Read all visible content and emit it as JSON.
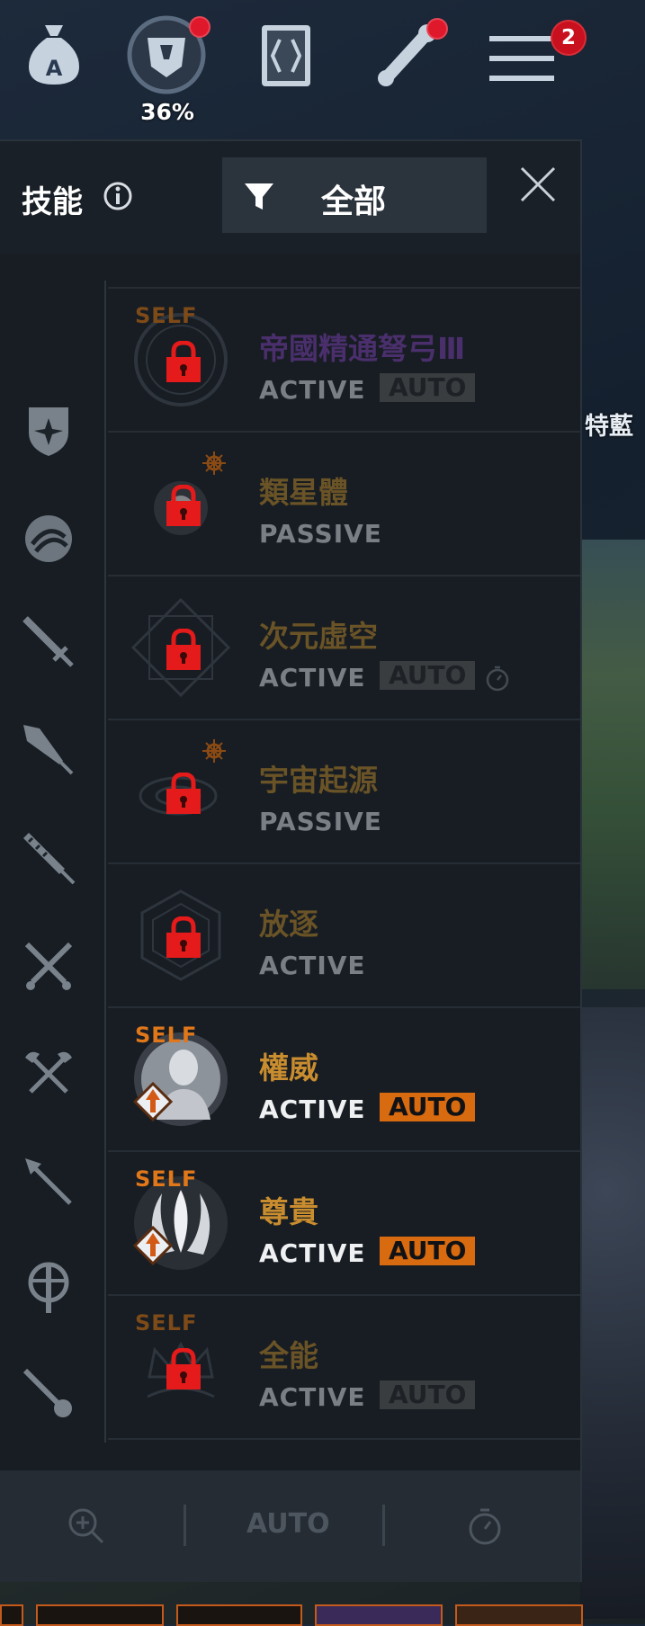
{
  "background": {
    "side_label": "特藍"
  },
  "hud": {
    "progress_percent": "36%",
    "menu_badge": "2"
  },
  "panel": {
    "title": "技能",
    "filter_label": "全部"
  },
  "skills": [
    {
      "name": "帝國精通弩弓Ⅲ",
      "type": "ACTIVE",
      "auto": "AUTO",
      "self": "SELF",
      "locked": true
    },
    {
      "name": "類星體",
      "type": "PASSIVE",
      "locked": true
    },
    {
      "name": "次元虛空",
      "type": "ACTIVE",
      "auto": "AUTO",
      "locked": true
    },
    {
      "name": "宇宙起源",
      "type": "PASSIVE",
      "locked": true
    },
    {
      "name": "放逐",
      "type": "ACTIVE",
      "locked": true
    },
    {
      "name": "權威",
      "type": "ACTIVE",
      "auto": "AUTO",
      "self": "SELF",
      "locked": false
    },
    {
      "name": "尊貴",
      "type": "ACTIVE",
      "auto": "AUTO",
      "self": "SELF",
      "locked": false
    },
    {
      "name": "全能",
      "type": "ACTIVE",
      "auto": "AUTO",
      "self": "SELF",
      "locked": true
    }
  ],
  "footer": {
    "auto_label": "AUTO"
  },
  "colors": {
    "accent": "#d86a10",
    "lock": "#e51a1a",
    "badge": "#c8101e"
  }
}
